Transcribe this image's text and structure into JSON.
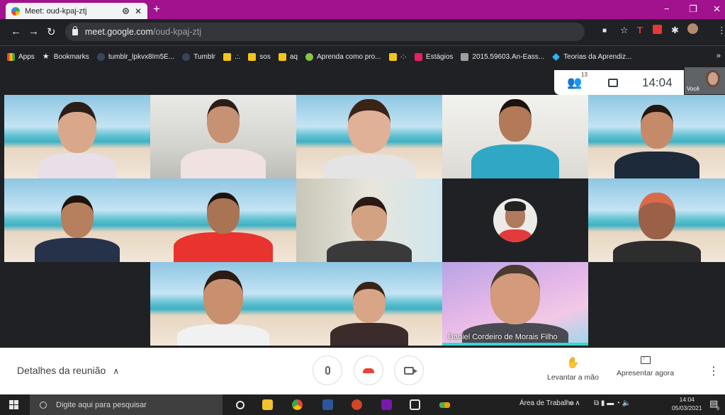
{
  "browser": {
    "tab_title": "Meet: oud-kpaj-ztj",
    "new_tab": "+",
    "url_host": "meet.google.com",
    "url_path": "/oud-kpaj-ztj",
    "window_controls": [
      "−",
      "❐",
      "✕"
    ]
  },
  "bookmarks": [
    {
      "label": "Apps",
      "color": "#ea4335"
    },
    {
      "label": "Bookmarks",
      "color": "#fbbc04"
    },
    {
      "label": "tumblr_lpkvx8Im5E...",
      "color": "#35465c"
    },
    {
      "label": "Tumblr",
      "color": "#35465c"
    },
    {
      "label": ".:.",
      "color": "#f5c518"
    },
    {
      "label": "sos",
      "color": "#f5c518"
    },
    {
      "label": "aq",
      "color": "#f5c518"
    },
    {
      "label": "Aprenda como pro...",
      "color": "#8bc34a"
    },
    {
      "label": "·:·",
      "color": "#f5c518"
    },
    {
      "label": "Estágios",
      "color": "#e91e63"
    },
    {
      "label": "2015.59603.An-Eass...",
      "color": "#9e9e9e"
    },
    {
      "label": "Teorias da Aprendiz...",
      "color": "#29b6f6"
    }
  ],
  "meeting": {
    "participant_count": "13",
    "time": "14:04",
    "self_label": "Você",
    "speaker_name": "Daniel Cordeiro de Morais Filho"
  },
  "controls": {
    "details_label": "Detalhes da reunião",
    "raise_hand_label": "Levantar a mão",
    "present_label": "Apresentar agora"
  },
  "taskbar": {
    "search_placeholder": "Digite aqui para pesquisar",
    "desktop_label": "Área de Trabalho",
    "time": "14:04",
    "date": "05/03/2021",
    "notification_count": "9"
  }
}
